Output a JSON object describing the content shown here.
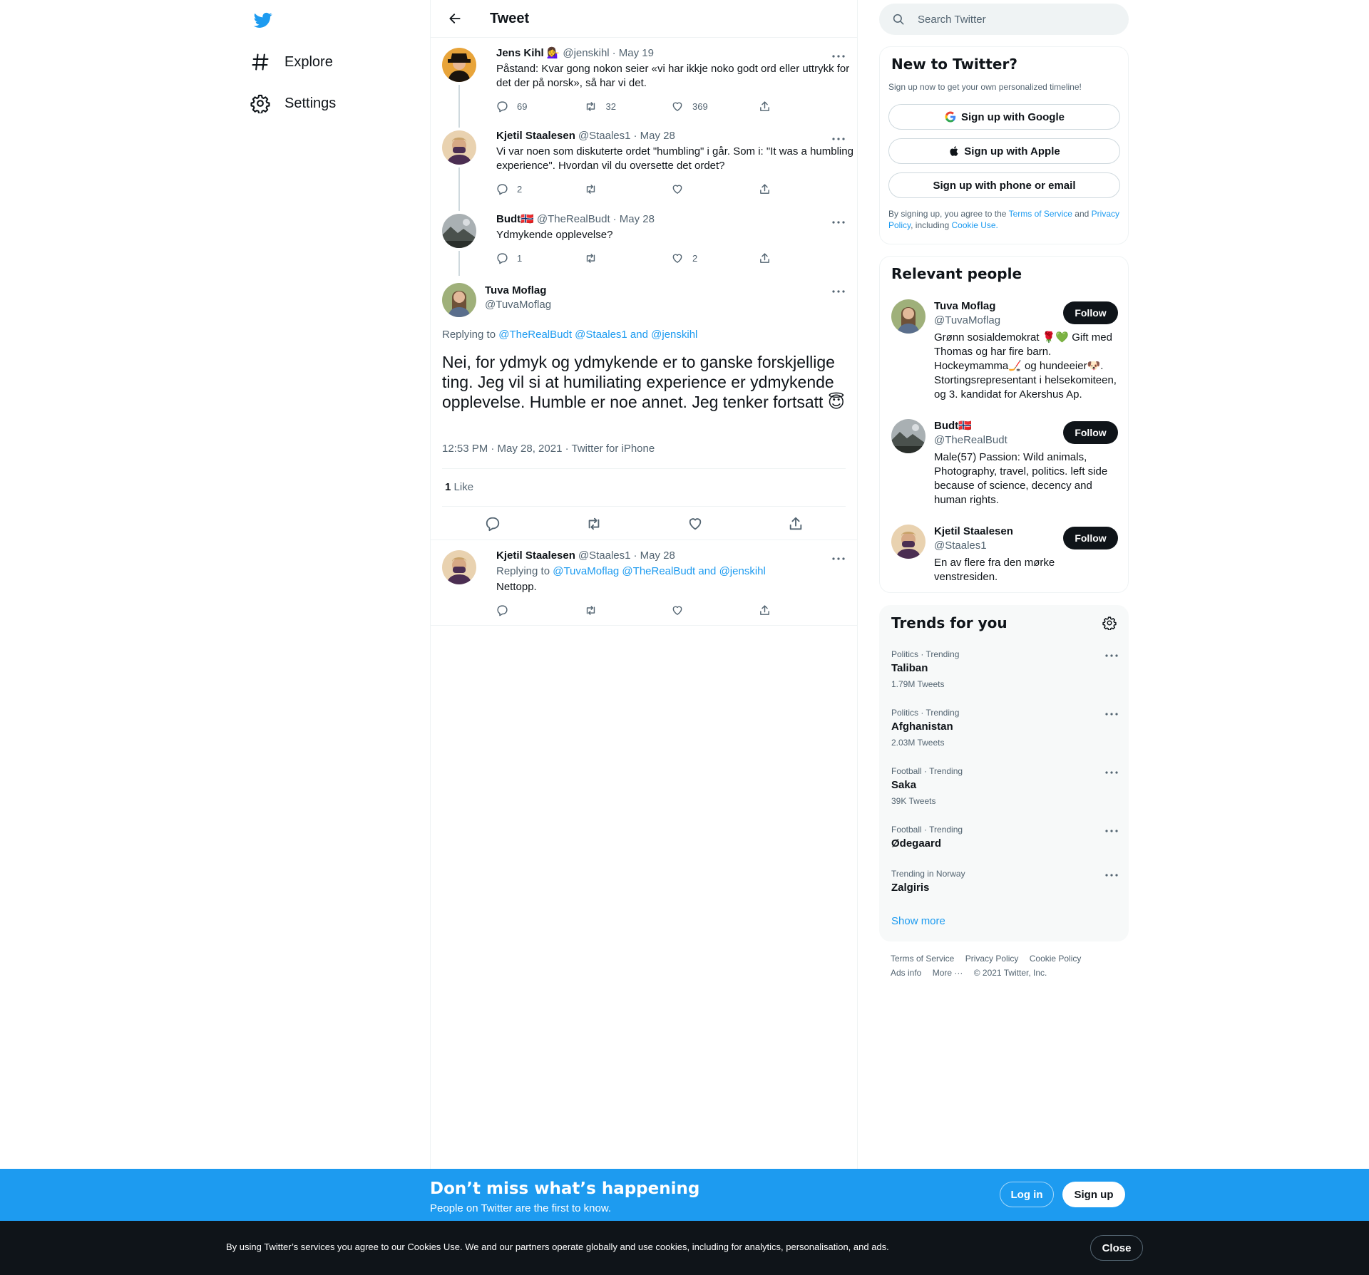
{
  "nav": {
    "explore": "Explore",
    "settings": "Settings"
  },
  "header": {
    "title": "Tweet"
  },
  "thread": [
    {
      "name": "Jens Kihl",
      "emoji": "💁‍♀️",
      "handle": "@jenskihl",
      "date": "· May 19",
      "text": "Påstand: Kvar gong nokon seier «vi har ikkje noko godt ord eller uttrykk for det der på norsk», så har vi det.",
      "replies": "69",
      "retweets": "32",
      "likes": "369"
    },
    {
      "name": "Kjetil Staalesen",
      "handle": "@Staales1",
      "date": "· May 28",
      "text": "Vi var noen som diskuterte ordet \"humbling\" i går. Som i: \"It was a humbling experience\". Hvordan vil du oversette det ordet?",
      "replies": "2",
      "retweets": "",
      "likes": ""
    },
    {
      "name": "Budt🇳🇴",
      "handle": "@TheRealBudt",
      "date": "· May 28",
      "text": "Ydmykende opplevelse?",
      "replies": "1",
      "retweets": "",
      "likes": "2"
    }
  ],
  "focus": {
    "name": "Tuva Moflag",
    "handle": "@TuvaMoflag",
    "replying_prefix": "Replying to",
    "replying_to": "@TheRealBudt @Staales1 and @jenskihl",
    "text": "Nei, for ydmyk og ydmykende er to ganske forskjellige ting. Jeg vil si at humiliating experience er ydmykende opplevelse. Humble er noe annet. Jeg tenker fortsatt",
    "emoji": "😇",
    "meta": "12:53 PM · May 28, 2021 · Twitter for iPhone",
    "like_count": "1",
    "like_label": "Like"
  },
  "reply": {
    "name": "Kjetil Staalesen",
    "handle": "@Staales1",
    "date": "· May 28",
    "replying_prefix": "Replying to",
    "replying_to": "@TuvaMoflag @TheRealBudt and @jenskihl",
    "text": "Nettopp."
  },
  "search": {
    "placeholder": "Search Twitter"
  },
  "signup": {
    "title": "New to Twitter?",
    "subtitle": "Sign up now to get your own personalized timeline!",
    "google": "Sign up with Google",
    "apple": "Sign up with Apple",
    "phone": "Sign up with phone or email",
    "legal_1": "By signing up, you agree to the",
    "tos": "Terms of Service",
    "and": "and",
    "privacy": "Privacy Policy",
    "including": ", including",
    "cookie": "Cookie Use."
  },
  "relevant": {
    "title": "Relevant people",
    "follow_label": "Follow",
    "people": [
      {
        "name": "Tuva Moflag",
        "handle": "@TuvaMoflag",
        "bio": "Grønn sosialdemokrat 🌹💚 Gift med Thomas og har fire barn. Hockeymamma🏒 og hundeeier🐶. Stortingsrepresentant i helsekomiteen, og 3. kandidat for Akershus Ap."
      },
      {
        "name": "Budt🇳🇴",
        "handle": "@TheRealBudt",
        "bio": "Male(57) Passion: Wild animals, Photography, travel, politics. left side because of science, decency and human rights."
      },
      {
        "name": "Kjetil Staalesen",
        "handle": "@Staales1",
        "bio": "En av flere fra den mørke venstresiden."
      }
    ]
  },
  "trends": {
    "title": "Trends for you",
    "items": [
      {
        "category": "Politics · Trending",
        "name": "Taliban",
        "count": "1.79M Tweets"
      },
      {
        "category": "Politics · Trending",
        "name": "Afghanistan",
        "count": "2.03M Tweets"
      },
      {
        "category": "Football · Trending",
        "name": "Saka",
        "count": "39K Tweets"
      },
      {
        "category": "Football · Trending",
        "name": "Ødegaard",
        "count": ""
      },
      {
        "category": "Trending in Norway",
        "name": "Zalgiris",
        "count": ""
      }
    ],
    "show_more": "Show more"
  },
  "footer": {
    "tos": "Terms of Service",
    "privacy": "Privacy Policy",
    "cookie": "Cookie Policy",
    "ads": "Ads info",
    "more": "More ···",
    "copyright": "© 2021 Twitter, Inc."
  },
  "banner": {
    "title": "Don’t miss what’s happening",
    "subtitle": "People on Twitter are the first to know.",
    "login": "Log in",
    "signup": "Sign up"
  },
  "cookie_bar": {
    "text": "By using Twitter’s services you agree to our Cookies Use. We and our partners operate globally and use cookies, including for analytics, personalisation, and ads.",
    "close": "Close"
  },
  "colors": {
    "accent": "#1d9bf0",
    "text": "#0f1419",
    "muted": "#536471",
    "border": "#eff3f4",
    "cookie_bg": "#0f1419"
  }
}
